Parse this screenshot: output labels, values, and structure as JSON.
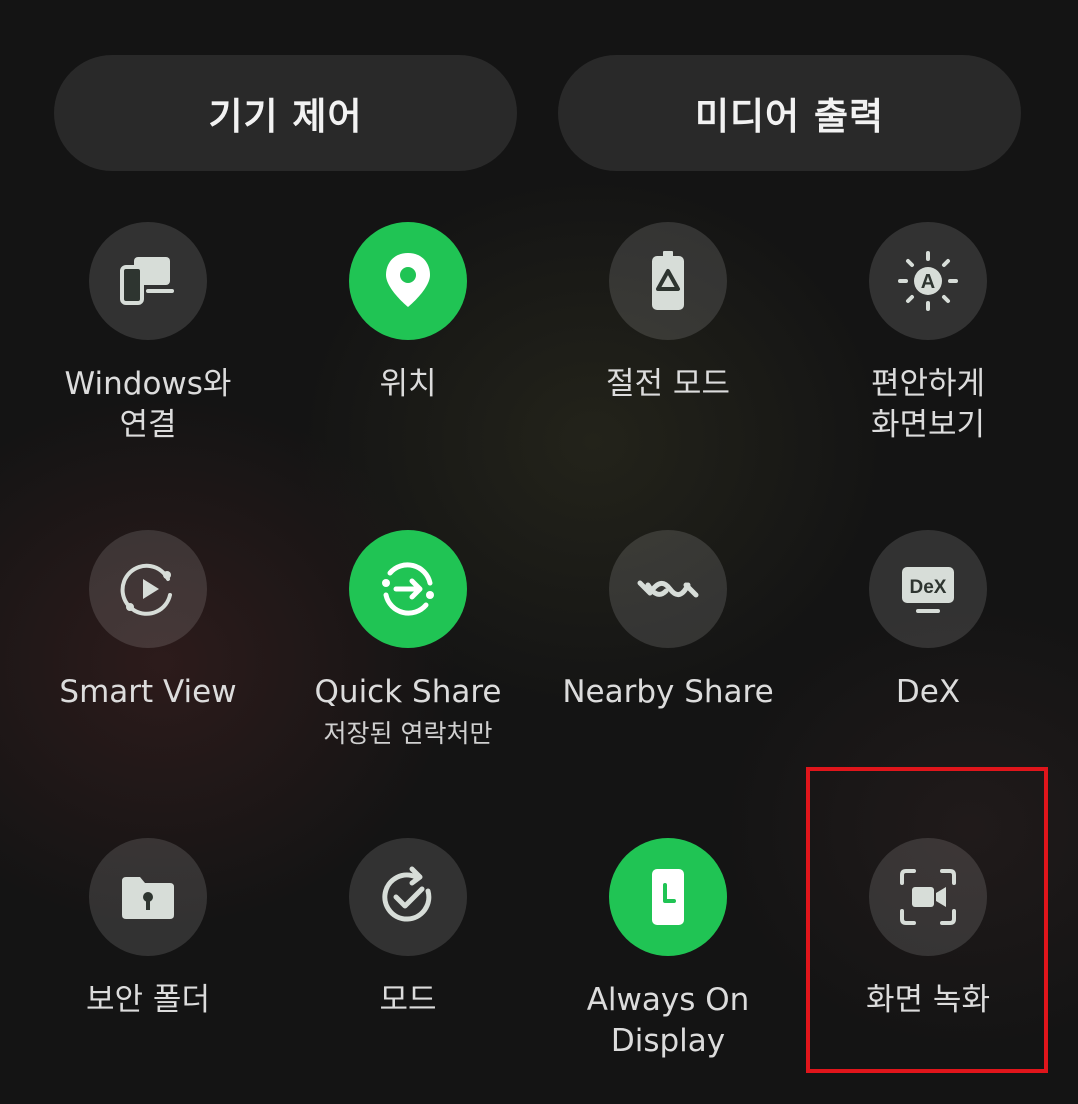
{
  "top_buttons": {
    "device_control": "기기 제어",
    "media_output": "미디어 출력"
  },
  "tiles": [
    {
      "label": "Windows와\n연결",
      "icon": "link-to-windows-icon",
      "active": false
    },
    {
      "label": "위치",
      "icon": "location-pin-icon",
      "active": true
    },
    {
      "label": "절전 모드",
      "icon": "power-saving-battery-icon",
      "active": false
    },
    {
      "label": "편안하게\n화면보기",
      "icon": "eye-comfort-brightness-icon",
      "active": false
    },
    {
      "label": "Smart View",
      "icon": "smart-view-icon",
      "active": false
    },
    {
      "label": "Quick Share",
      "sublabel": "저장된 연락처만",
      "icon": "quick-share-icon",
      "active": true
    },
    {
      "label": "Nearby Share",
      "icon": "nearby-share-icon",
      "active": false
    },
    {
      "label": "DeX",
      "icon": "dex-monitor-icon",
      "icon_text": "DeX",
      "active": false
    },
    {
      "label": "보안 폴더",
      "icon": "secure-folder-icon",
      "active": false
    },
    {
      "label": "모드",
      "icon": "modes-icon",
      "active": false
    },
    {
      "label": "Always On\nDisplay",
      "icon": "always-on-display-icon",
      "active": true
    },
    {
      "label": "화면 녹화",
      "icon": "screen-recorder-icon",
      "active": false
    }
  ],
  "colors": {
    "active": "#20c454",
    "inactive": "#2e3530",
    "highlight_box": "#e0151b"
  }
}
